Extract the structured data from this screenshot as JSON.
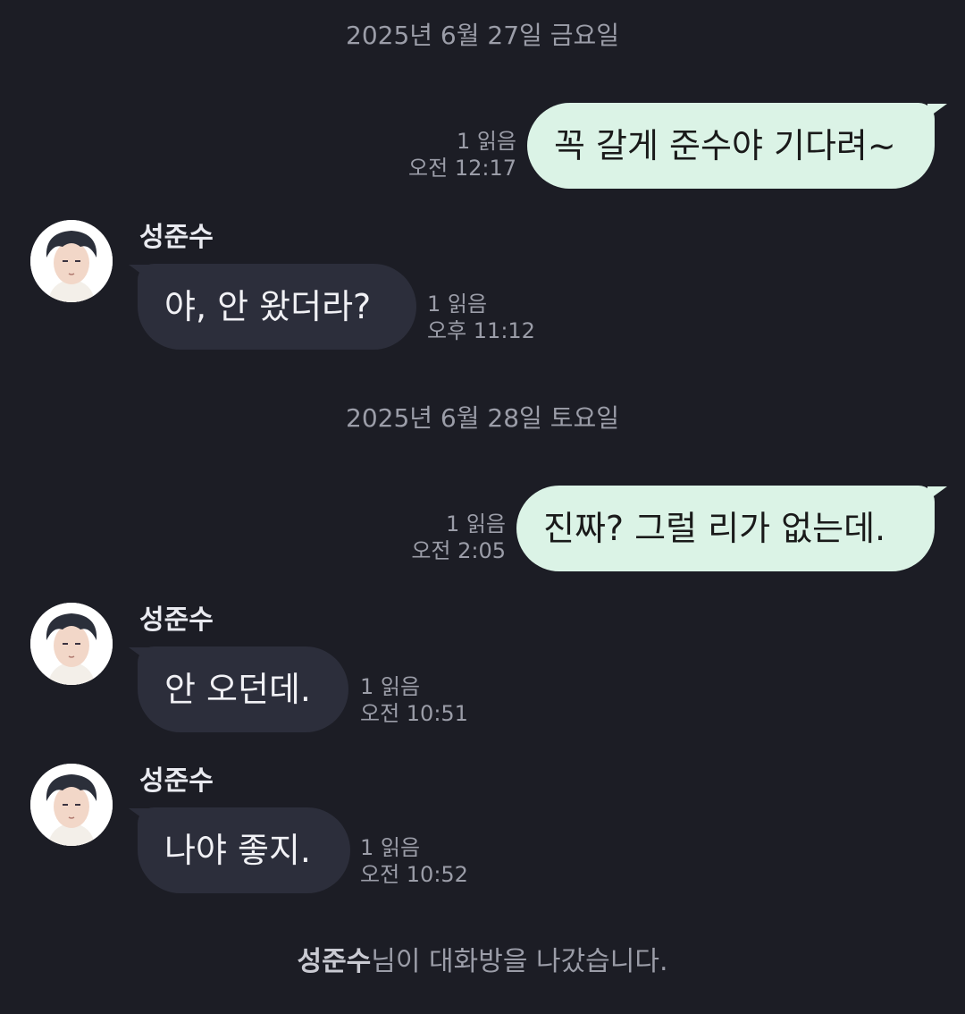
{
  "dates": [
    {
      "label": "2025년 6월 27일 금요일"
    },
    {
      "label": "2025년 6월 28일 토요일"
    }
  ],
  "messages": [
    {
      "direction": "out",
      "text": "꼭 갈게 준수야 기다려~",
      "read": "1 읽음",
      "time": "오전 12:17"
    },
    {
      "direction": "in",
      "sender": "성준수",
      "text": "야, 안 왔더라?",
      "read": "1 읽음",
      "time": "오후 11:12"
    },
    {
      "direction": "out",
      "text": "진짜?  그럴 리가 없는데.",
      "read": "1 읽음",
      "time": "오전 2:05"
    },
    {
      "direction": "in",
      "sender": "성준수",
      "text": "안 오던데.",
      "read": "1 읽음",
      "time": "오전 10:51"
    },
    {
      "direction": "in",
      "sender": "성준수",
      "text": "나야 좋지.",
      "read": "1 읽음",
      "time": "오전 10:52"
    }
  ],
  "system": {
    "name": "성준수",
    "text": "님이 대화방을 나갔습니다."
  },
  "colors": {
    "background": "#1c1d25",
    "outgoing_bubble": "#dbf3e6",
    "incoming_bubble": "#2c2e3b",
    "meta_text": "#9b9da8"
  },
  "icons": {
    "avatar": "profile-avatar-icon"
  }
}
